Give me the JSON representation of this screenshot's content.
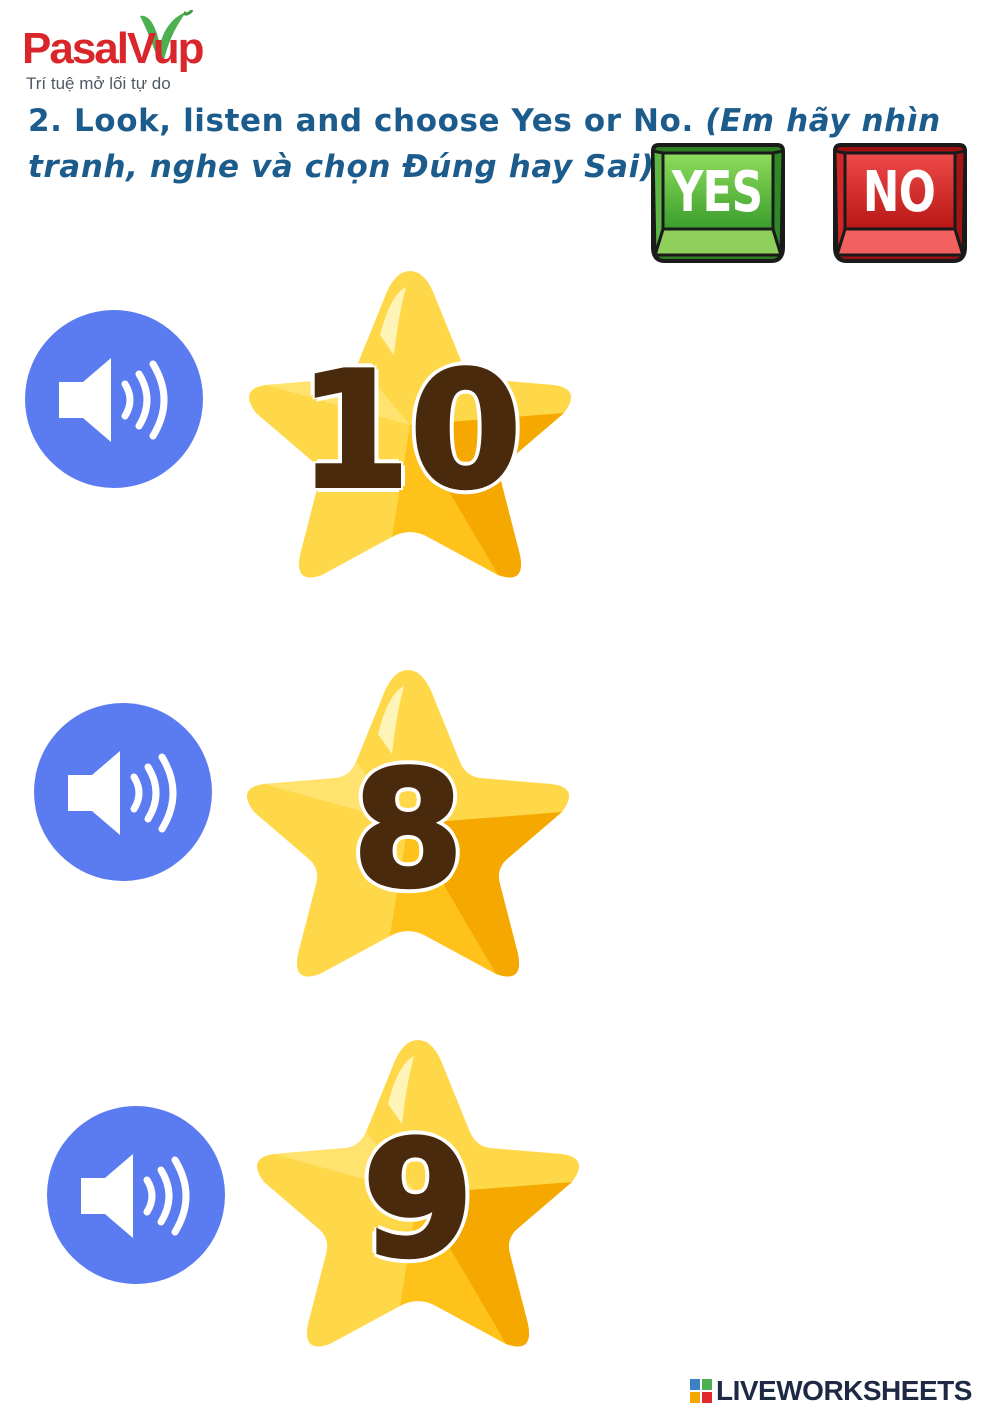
{
  "logo": {
    "brand": "PasalVup",
    "tagline": "Trí tuệ mở lối tự do",
    "color": "#d9262b",
    "leaf_color": "#4caf50"
  },
  "instruction": {
    "text": "2. Look, listen and choose Yes or No.",
    "translation": "(Em hãy nhìn tranh, nghe và chọn Đúng hay Sai)",
    "color": "#1c5c8c"
  },
  "answer_keys": {
    "yes_label": "YES",
    "no_label": "NO",
    "yes_color": "#4cbf3a",
    "no_color": "#e12b2b"
  },
  "items": [
    {
      "number": "10",
      "icon": "speaker-icon"
    },
    {
      "number": "8",
      "icon": "speaker-icon"
    },
    {
      "number": "9",
      "icon": "speaker-icon"
    }
  ],
  "colors": {
    "speaker": "#5b7cf0",
    "star_light": "#ffd84a",
    "star_dark": "#f5a800",
    "number": "#4a2a0d"
  },
  "footer": {
    "brand": "LIVEWORKSHEETS"
  }
}
